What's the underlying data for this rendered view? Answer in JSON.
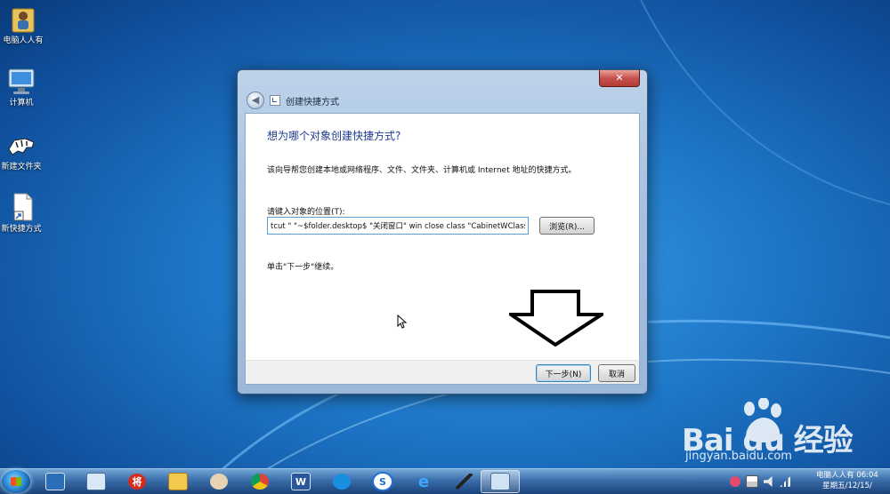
{
  "desktop": {
    "icons": [
      {
        "label": "电脑人人有"
      },
      {
        "label": "计算机"
      },
      {
        "label": "新建文件夹"
      },
      {
        "label": "新快捷方式"
      }
    ]
  },
  "dialog": {
    "title": "创建快捷方式",
    "close_label": "✕",
    "heading": "想为哪个对象创建快捷方式?",
    "description": "该向导帮您创建本地或网络程序、文件、文件夹、计算机或 Internet 地址的快捷方式。",
    "location_label": "请键入对象的位置(T):",
    "location_value": "tcut \" \"~$folder.desktop$ \"关闭窗口\" win close class \"CabinetWClass\"",
    "browse_label": "浏览(R)...",
    "hint": "单击\"下一步\"继续。",
    "next_label": "下一步(N)",
    "cancel_label": "取消"
  },
  "taskbar": {
    "clock_line1": "电脑人人有 06:04",
    "clock_line2": "星期五/12/15/",
    "items": [
      {
        "glyph": ""
      },
      {
        "glyph": ""
      },
      {
        "glyph": "将"
      },
      {
        "glyph": ""
      },
      {
        "glyph": ""
      },
      {
        "glyph": ""
      },
      {
        "glyph": "W"
      },
      {
        "glyph": ""
      },
      {
        "glyph": "S"
      },
      {
        "glyph": "e"
      },
      {
        "glyph": ""
      },
      {
        "glyph": ""
      }
    ]
  },
  "watermark": {
    "logo": "Bai du 经验",
    "url": "jingyan.baidu.com"
  }
}
